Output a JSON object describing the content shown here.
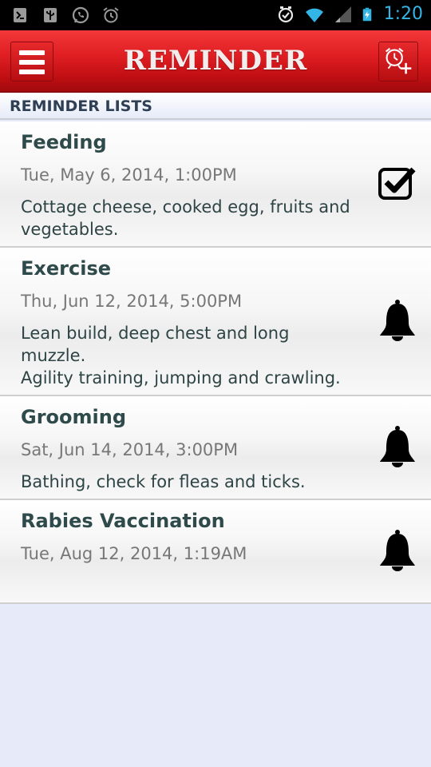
{
  "status_bar": {
    "time": "1:20",
    "left_icons": [
      "usb-debug-icon",
      "usb-icon",
      "whatsapp-icon",
      "alarm-clock-icon"
    ],
    "right_icons": [
      "alarm-set-icon",
      "wifi-icon",
      "signal-icon",
      "battery-charging-icon"
    ]
  },
  "header": {
    "title": "REMINDER",
    "menu_icon": "hamburger-menu-icon",
    "add_icon": "add-alarm-icon",
    "accent_color": "#e01f23"
  },
  "section": {
    "title": "REMINDER LISTS"
  },
  "reminders": [
    {
      "title": "Feeding",
      "date": "Tue, May 6, 2014, 1:00PM",
      "description": "Cottage cheese, cooked egg, fruits and\nvegetables.",
      "status_icon": "checkbox-checked-icon"
    },
    {
      "title": "Exercise",
      "date": "Thu, Jun 12, 2014, 5:00PM",
      "description": "Lean build, deep chest and long\nmuzzle.\nAgility training, jumping and crawling.",
      "status_icon": "bell-icon"
    },
    {
      "title": "Grooming",
      "date": "Sat, Jun 14, 2014, 3:00PM",
      "description": "Bathing, check for fleas and ticks.",
      "status_icon": "bell-icon"
    },
    {
      "title": "Rabies Vaccination",
      "date": "Tue, Aug 12, 2014, 1:19AM",
      "description": "",
      "status_icon": "bell-icon"
    }
  ]
}
